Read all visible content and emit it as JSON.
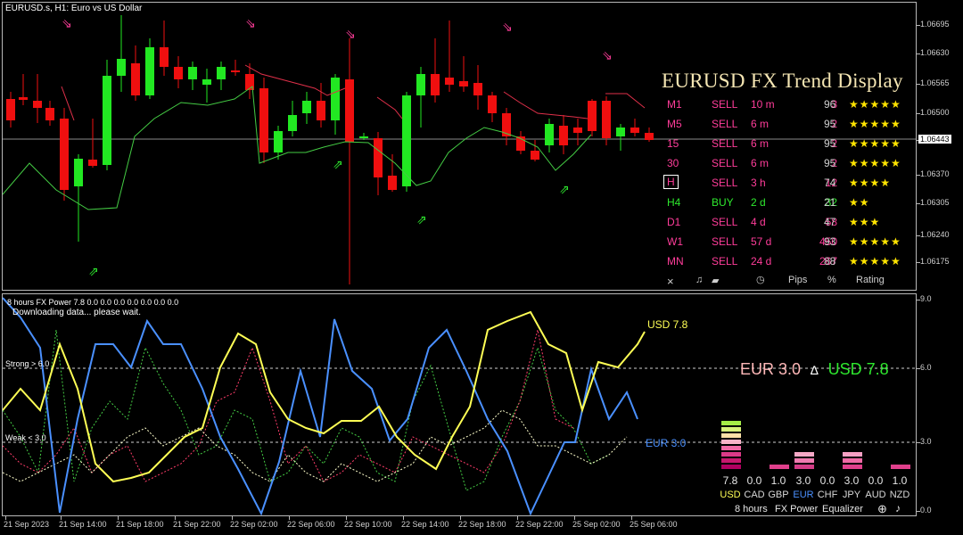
{
  "window_title": "EURUSD.s, H1:  Euro vs US Dollar",
  "main_yaxis": [
    "1.06695",
    "1.06630",
    "1.06565",
    "1.06500",
    "1.06443",
    "1.06370",
    "1.06305",
    "1.06240",
    "1.06175"
  ],
  "price_marker": "1.06443",
  "indicator_yaxis": [
    "9.0",
    "6.0",
    "3.0",
    "0.0"
  ],
  "xaxis": [
    "21 Sep 2023",
    "21 Sep 14:00",
    "21 Sep 18:00",
    "21 Sep 22:00",
    "22 Sep 02:00",
    "22 Sep 06:00",
    "22 Sep 10:00",
    "22 Sep 14:00",
    "22 Sep 18:00",
    "22 Sep 22:00",
    "25 Sep 02:00",
    "25 Sep 06:00"
  ],
  "trend": {
    "title": "EURUSD FX Trend Display",
    "rows": [
      {
        "tf": "M1",
        "dir": "SELL",
        "time": "10 m",
        "pips": "3",
        "pct": "96",
        "stars": "★★★★★"
      },
      {
        "tf": "M5",
        "dir": "SELL",
        "time": "6 m",
        "pips": "2",
        "pct": "95",
        "stars": "★★★★★"
      },
      {
        "tf": "15",
        "dir": "SELL",
        "time": "6 m",
        "pips": "2",
        "pct": "95",
        "stars": "★★★★★"
      },
      {
        "tf": "30",
        "dir": "SELL",
        "time": "6 m",
        "pips": "2",
        "pct": "95",
        "stars": "★★★★★"
      },
      {
        "tf": "H",
        "dir": "SELL",
        "time": "3 h",
        "pips": "12",
        "pct": "74",
        "stars": "★★★★"
      },
      {
        "tf": "H4",
        "dir": "BUY",
        "time": "2 d",
        "pips": "32",
        "pct": "21",
        "stars": "★★"
      },
      {
        "tf": "D1",
        "dir": "SELL",
        "time": "4 d",
        "pips": "58",
        "pct": "47",
        "stars": "★★★"
      },
      {
        "tf": "W1",
        "dir": "SELL",
        "time": "57 d",
        "pips": "450",
        "pct": "93",
        "stars": "★★★★★"
      },
      {
        "tf": "MN",
        "dir": "SELL",
        "time": "24 d",
        "pips": "267",
        "pct": "88",
        "stars": "★★★★★"
      }
    ],
    "footer": {
      "close": "×",
      "pips": "Pips",
      "pct": "%",
      "rating": "Rating"
    }
  },
  "indicator": {
    "header": "8 hours FX Power 7.8 0.0 0.0 0.0 0.0 0.0 0.0 0.0",
    "status": "Downloading data... please wait.",
    "strong_label": "Strong > 6.0",
    "weak_label": "Weak < 3.0",
    "usd_label": "USD 7.8",
    "eur_label": "EUR 3.0",
    "big_eur": "EUR 3.0",
    "big_delta": "∆",
    "big_usd": "USD 7.8",
    "currencies": [
      "USD",
      "CAD",
      "GBP",
      "EUR",
      "CHF",
      "JPY",
      "AUD",
      "NZD"
    ],
    "values": [
      "7.8",
      "0.0",
      "1.0",
      "3.0",
      "0.0",
      "3.0",
      "0.0",
      "1.0"
    ],
    "footer_period": "8 hours",
    "footer_name": "FX Power",
    "footer_eq": "Equalizer"
  },
  "colors": {
    "bull": "#22e822",
    "bear": "#f00f0f",
    "usd": "#ffff55",
    "eur": "#4a90ff",
    "sell": "#ff3d9a",
    "buy": "#2ee82e",
    "stars": "#ffe400"
  }
}
